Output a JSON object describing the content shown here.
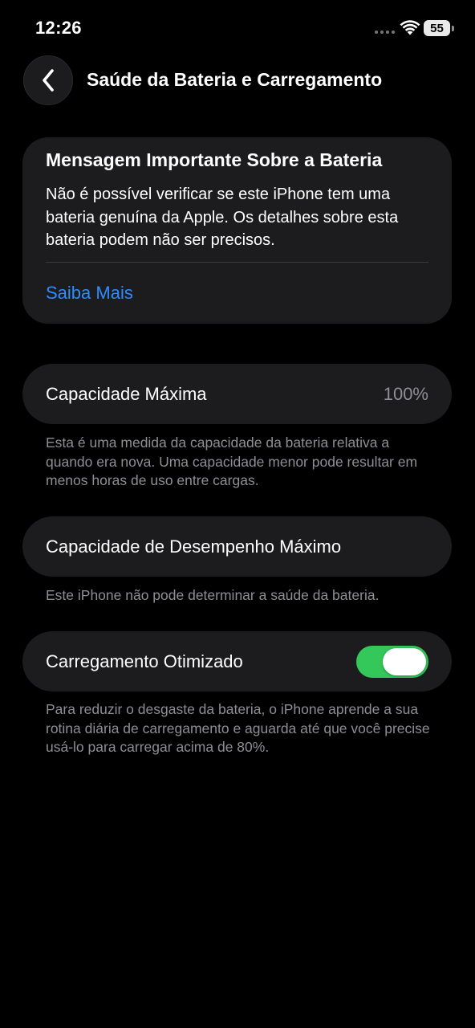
{
  "status_bar": {
    "time": "12:26",
    "battery_level": "55"
  },
  "nav": {
    "title": "Saúde da Bateria e Carregamento"
  },
  "important_message": {
    "title": "Mensagem Importante Sobre a Bateria",
    "body": "Não é possível verificar se este iPhone tem uma bateria genuína da Apple. Os detalhes sobre esta bateria podem não ser precisos.",
    "link_label": "Saiba Mais"
  },
  "max_capacity": {
    "label": "Capacidade Máxima",
    "value": "100%",
    "footnote": "Esta é uma medida da capacidade da bateria relativa a quando era nova. Uma capacidade menor pode resultar em menos horas de uso entre cargas."
  },
  "peak_performance": {
    "label": "Capacidade de Desempenho Máximo",
    "footnote": "Este iPhone não pode determinar a saúde da bateria."
  },
  "optimized_charging": {
    "label": "Carregamento Otimizado",
    "enabled": true,
    "footnote": "Para reduzir o desgaste da bateria, o iPhone aprende a sua rotina diária de carregamento e aguarda até que você precise usá-lo para carregar acima de 80%."
  },
  "colors": {
    "background": "#000000",
    "card": "#1c1c1e",
    "link": "#2f8cff",
    "toggle_on": "#34c759",
    "secondary_text": "#8e8e93"
  }
}
